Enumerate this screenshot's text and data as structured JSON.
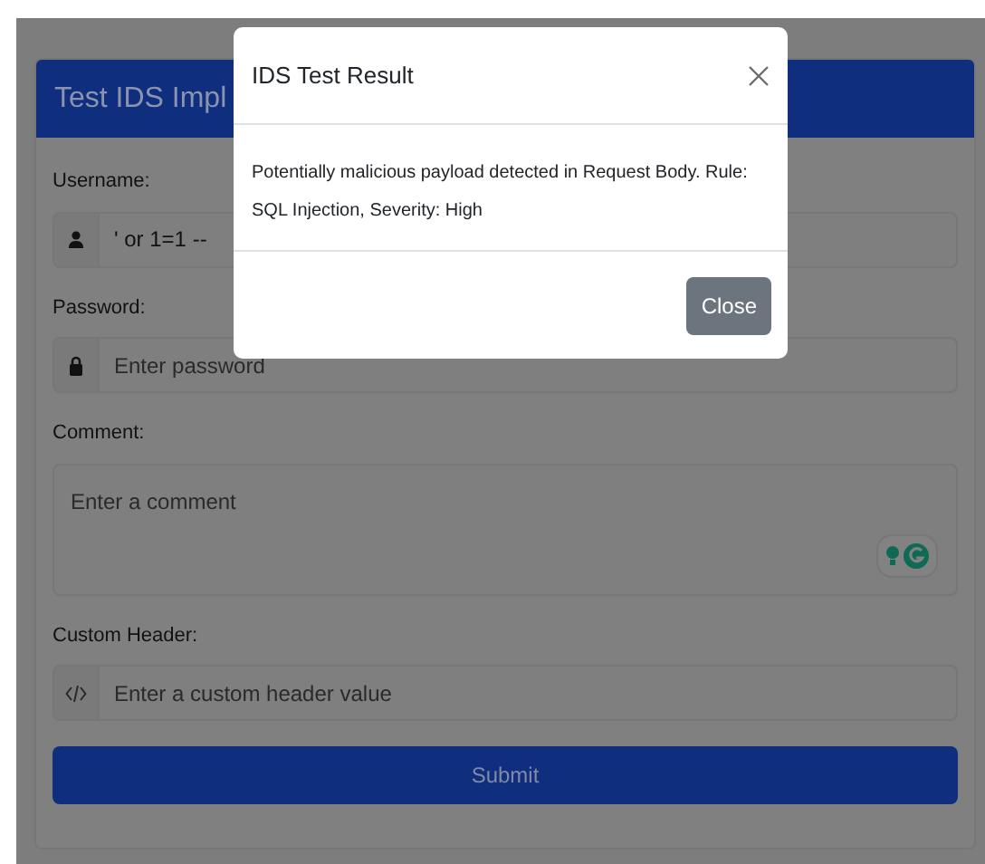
{
  "page": {
    "title": "Test IDS Impl",
    "fields": [
      {
        "kind": "username",
        "label": "Username:",
        "value": "' or 1=1 --"
      },
      {
        "kind": "password",
        "label": "Password:",
        "placeholder": "Enter password"
      },
      {
        "kind": "textarea",
        "label": "Comment:",
        "placeholder": "Enter a comment"
      },
      {
        "kind": "header",
        "label": "Custom Header:",
        "placeholder": "Enter a custom header value"
      }
    ],
    "submit": "Submit"
  },
  "dialog": {
    "title": "IDS Test Result",
    "message": "Potentially malicious payload detected in Request Body. Rule: SQL Injection, Severity: High",
    "buttons": [
      "Close"
    ]
  }
}
